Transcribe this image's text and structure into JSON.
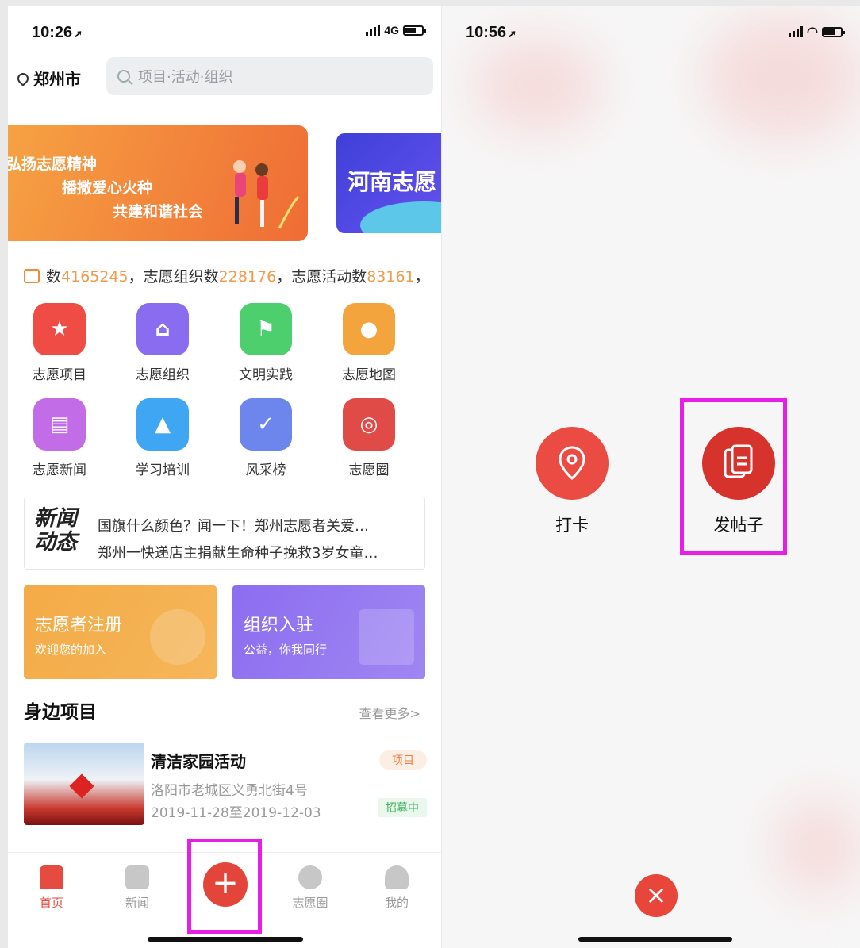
{
  "left": {
    "status": {
      "time": "10:26",
      "network": "4G"
    },
    "city": "郑州市",
    "search_placeholder": "项目·活动·组织",
    "banner1": {
      "line1": "弘扬志愿精神",
      "line2": "播撒爱心火种",
      "line3": "共建和谐社会"
    },
    "banner2": {
      "text": "河南志愿"
    },
    "ticker": {
      "prefix": "数",
      "v1": "4165245",
      "mid1": "，志愿组织数",
      "v2": "228176",
      "mid2": "，志愿活动数",
      "v3": "83161",
      "suffix": "，"
    },
    "grid": [
      {
        "label": "志愿项目",
        "color": "#ee4c44",
        "icon": "bookmark-icon"
      },
      {
        "label": "志愿组织",
        "color": "#8a6cf0",
        "icon": "building-icon"
      },
      {
        "label": "文明实践",
        "color": "#4ccf6c",
        "icon": "flag-icon"
      },
      {
        "label": "志愿地图",
        "color": "#f4a43c",
        "icon": "map-pin-icon"
      },
      {
        "label": "志愿新闻",
        "color": "#c26ce8",
        "icon": "newspaper-icon"
      },
      {
        "label": "学习培训",
        "color": "#3ea6f2",
        "icon": "graduation-cap-icon"
      },
      {
        "label": "风采榜",
        "color": "#6c86ee",
        "icon": "shield-check-icon"
      },
      {
        "label": "志愿圈",
        "color": "#e04b48",
        "icon": "target-icon"
      }
    ],
    "news": {
      "logo": "新闻动态",
      "line1": "国旗什么颜色？闻一下！郑州志愿者关爱…",
      "line2": "郑州一快递店主捐献生命种子挽救3岁女童…"
    },
    "cards": [
      {
        "title": "志愿者注册",
        "subtitle": "欢迎您的加入",
        "color": "#f3ab46"
      },
      {
        "title": "组织入驻",
        "subtitle": "公益，你我同行",
        "color": "#8c6df0"
      }
    ],
    "section": {
      "title": "身边项目",
      "more": "查看更多>"
    },
    "item": {
      "title": "清洁家园活动",
      "address": "洛阳市老城区义勇北街4号",
      "date": "2019-11-28至2019-12-03",
      "tag_type": "项目",
      "tag_status": "招募中"
    },
    "tabs": [
      {
        "label": "首页",
        "icon": "home-icon"
      },
      {
        "label": "新闻",
        "icon": "news-icon"
      },
      {
        "label": "志愿圈",
        "icon": "eye-icon"
      },
      {
        "label": "我的",
        "icon": "user-icon"
      }
    ],
    "plus": "+"
  },
  "right": {
    "status": {
      "time": "10:56"
    },
    "actions": [
      {
        "label": "打卡",
        "icon": "location-pin-icon"
      },
      {
        "label": "发帖子",
        "icon": "document-copy-icon"
      }
    ],
    "close": "×"
  },
  "colors": {
    "accent": "#e54b3f",
    "highlight": "#e81ee6",
    "orange": "#f29a4c"
  }
}
